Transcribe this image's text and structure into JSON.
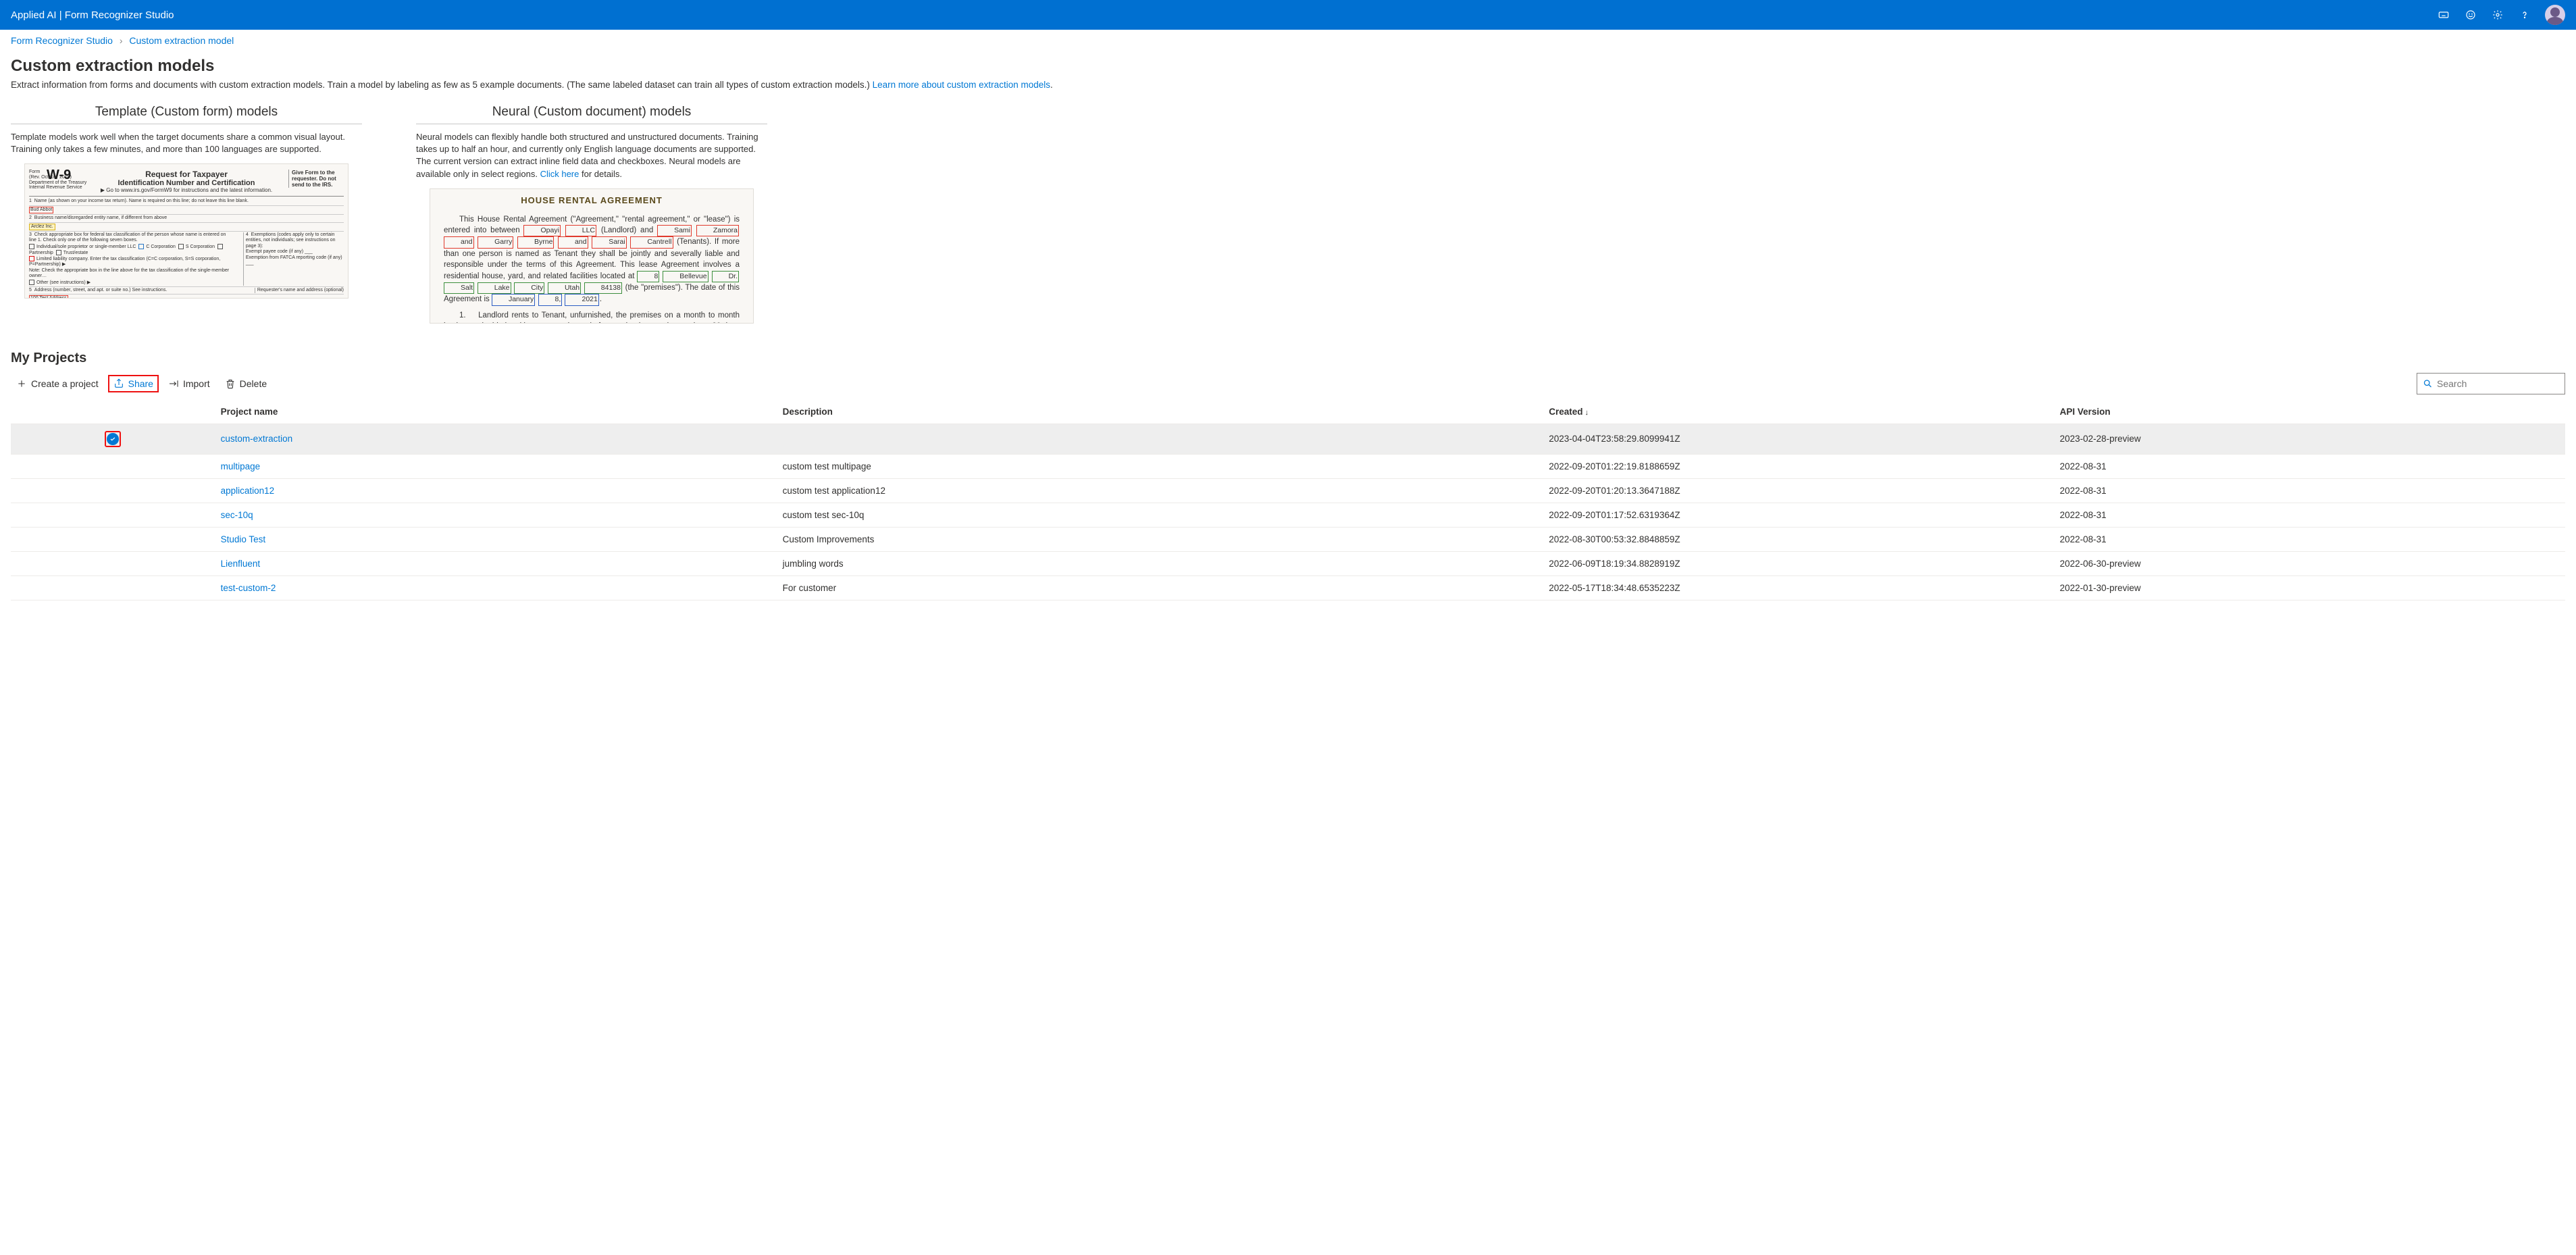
{
  "header": {
    "app_title": "Applied AI | Form Recognizer Studio"
  },
  "breadcrumb": {
    "root": "Form Recognizer Studio",
    "current": "Custom extraction model"
  },
  "page": {
    "title": "Custom extraction models",
    "subtitle_pre": "Extract information from forms and documents with custom extraction models. Train a model by labeling as few as 5 example documents. (The same labeled dataset can train all types of custom extraction models.) ",
    "subtitle_link": "Learn more about custom extraction models"
  },
  "cards": {
    "template": {
      "title": "Template (Custom form) models",
      "desc": "Template models work well when the target documents share a common visual layout. Training only takes a few minutes, and more than 100 languages are supported."
    },
    "neural": {
      "title": "Neural (Custom document) models",
      "desc_pre": "Neural models can flexibly handle both structured and unstructured documents. Training takes up to half an hour, and currently only English language documents are supported. The current version can extract inline field data and checkboxes. Neural models are available only in select regions. ",
      "desc_link": "Click here",
      "desc_post": " for details."
    }
  },
  "projects_section_title": "My Projects",
  "toolbar": {
    "create": "Create a project",
    "share": "Share",
    "import": "Import",
    "delete": "Delete"
  },
  "search": {
    "placeholder": "Search"
  },
  "columns": {
    "name": "Project name",
    "desc": "Description",
    "created": "Created",
    "api": "API Version"
  },
  "projects": [
    {
      "name": "custom-extraction",
      "desc": "",
      "created": "2023-04-04T23:58:29.8099941Z",
      "api": "2023-02-28-preview",
      "selected": true
    },
    {
      "name": "multipage",
      "desc": "custom test multipage",
      "created": "2022-09-20T01:22:19.8188659Z",
      "api": "2022-08-31"
    },
    {
      "name": "application12",
      "desc": "custom test application12",
      "created": "2022-09-20T01:20:13.3647188Z",
      "api": "2022-08-31"
    },
    {
      "name": "sec-10q",
      "desc": "custom test sec-10q",
      "created": "2022-09-20T01:17:52.6319364Z",
      "api": "2022-08-31"
    },
    {
      "name": "Studio Test",
      "desc": "Custom Improvements",
      "created": "2022-08-30T00:53:32.8848859Z",
      "api": "2022-08-31"
    },
    {
      "name": "Lienfluent",
      "desc": "jumbling words",
      "created": "2022-06-09T18:19:34.8828919Z",
      "api": "2022-06-30-preview"
    },
    {
      "name": "test-custom-2",
      "desc": "For customer",
      "created": "2022-05-17T18:34:48.6535223Z",
      "api": "2022-01-30-preview"
    }
  ]
}
